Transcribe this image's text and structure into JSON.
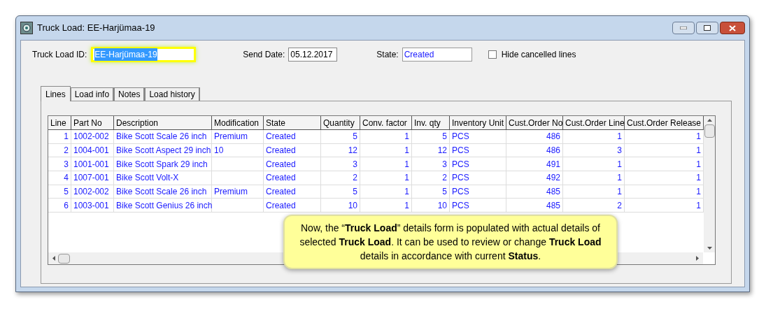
{
  "window": {
    "title": "Truck Load: EE-Harjümaa-19"
  },
  "header": {
    "truck_load_id": {
      "label": "Truck Load ID:",
      "value": "EE-Harjümaa-19",
      "highlighted": true
    },
    "send_date": {
      "label": "Send Date:",
      "value": "05.12.2017"
    },
    "state": {
      "label": "State:",
      "value": "Created"
    },
    "hide_cancelled": {
      "label": "Hide cancelled lines",
      "checked": false
    }
  },
  "tabs": [
    {
      "label": "Lines",
      "selected": true
    },
    {
      "label": "Load info",
      "selected": false
    },
    {
      "label": "Notes",
      "selected": false
    },
    {
      "label": "Load history",
      "selected": false
    }
  ],
  "table": {
    "columns": [
      {
        "label": "Line",
        "kind": "number"
      },
      {
        "label": "Part No",
        "kind": "text"
      },
      {
        "label": "Description",
        "kind": "text"
      },
      {
        "label": "Modification",
        "kind": "text"
      },
      {
        "label": "State",
        "kind": "text"
      },
      {
        "label": "Quantity",
        "kind": "number"
      },
      {
        "label": "Conv. factor",
        "kind": "number"
      },
      {
        "label": "Inv. qty",
        "kind": "number"
      },
      {
        "label": "Inventory Unit",
        "kind": "text"
      },
      {
        "label": "Cust.Order No",
        "kind": "number"
      },
      {
        "label": "Cust.Order Line",
        "kind": "number"
      },
      {
        "label": "Cust.Order Release",
        "kind": "number"
      }
    ],
    "rows": [
      [
        "1",
        "1002-002",
        "Bike Scott Scale 26 inch",
        "Premium",
        "Created",
        "5",
        "1",
        "5",
        "PCS",
        "486",
        "1",
        "1"
      ],
      [
        "2",
        "1004-001",
        "Bike Scott Aspect 29 inch",
        "10",
        "Created",
        "12",
        "1",
        "12",
        "PCS",
        "486",
        "3",
        "1"
      ],
      [
        "3",
        "1001-001",
        "Bike Scott Spark 29 inch",
        "",
        "Created",
        "3",
        "1",
        "3",
        "PCS",
        "491",
        "1",
        "1"
      ],
      [
        "4",
        "1007-001",
        "Bike Scott Volt-X",
        "",
        "Created",
        "2",
        "1",
        "2",
        "PCS",
        "492",
        "1",
        "1"
      ],
      [
        "5",
        "1002-002",
        "Bike Scott Scale 26 inch",
        "Premium",
        "Created",
        "5",
        "1",
        "5",
        "PCS",
        "485",
        "1",
        "1"
      ],
      [
        "6",
        "1003-001",
        "Bike Scott Genius 26 inch",
        "",
        "Created",
        "10",
        "1",
        "10",
        "PCS",
        "485",
        "2",
        "1"
      ]
    ]
  },
  "callout": {
    "text": "Now, the “**Truck Load**” details form is populated with actual details of selected **Truck Load**.  It can be used to review or change **Truck Load** details in accordance with current **Status**."
  }
}
